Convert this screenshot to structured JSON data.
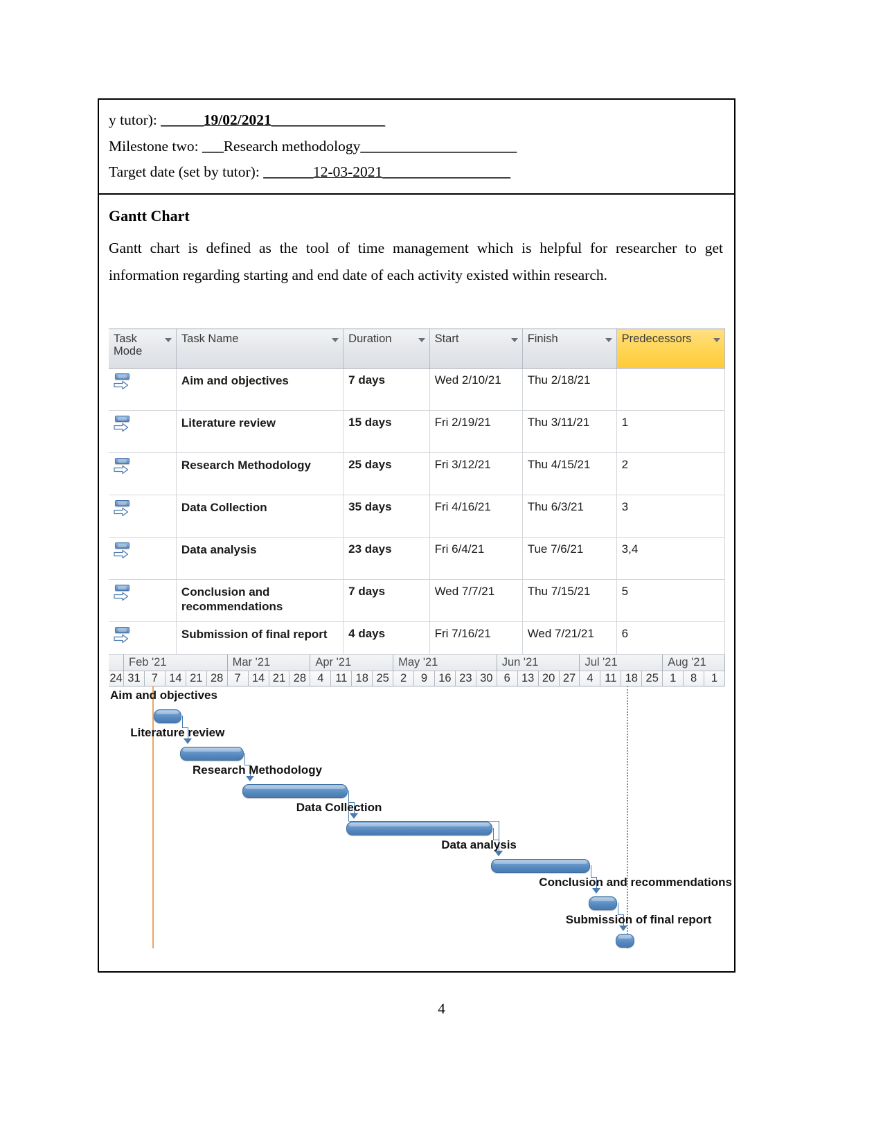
{
  "header": {
    "line1_prefix": "y tutor): ",
    "line1_blank_before": "______",
    "line1_value": "19/02/2021",
    "line1_blank_after": "________________",
    "line2_prefix": "Milestone two: ",
    "line2_blank_before": "___",
    "line2_value": "Research methodology",
    "line2_blank_after": "______________________",
    "line3_prefix": "Target date (set by tutor): ",
    "line3_blank_before": "_______",
    "line3_value": "12-03-2021",
    "line3_blank_after": "__________________"
  },
  "section": {
    "title": "Gantt Chart",
    "paragraph": "Gantt chart is defined as the tool of time management which is helpful for researcher to get information regarding starting and end date of each activity existed within research."
  },
  "project_table": {
    "columns": [
      {
        "label": "Task Mode",
        "highlight": false
      },
      {
        "label": "Task Name",
        "highlight": false
      },
      {
        "label": "Duration",
        "highlight": false
      },
      {
        "label": "Start",
        "highlight": false
      },
      {
        "label": "Finish",
        "highlight": false
      },
      {
        "label": "Predecessors",
        "highlight": true
      }
    ],
    "rows": [
      {
        "mode_icon": "auto-schedule-icon",
        "name": "Aim and objectives",
        "duration": "7 days",
        "start": "Wed 2/10/21",
        "finish": "Thu 2/18/21",
        "predecessors": ""
      },
      {
        "mode_icon": "auto-schedule-icon",
        "name": "Literature review",
        "duration": "15 days",
        "start": "Fri 2/19/21",
        "finish": "Thu 3/11/21",
        "predecessors": "1"
      },
      {
        "mode_icon": "auto-schedule-icon",
        "name": "Research Methodology",
        "duration": "25 days",
        "start": "Fri 3/12/21",
        "finish": "Thu 4/15/21",
        "predecessors": "2"
      },
      {
        "mode_icon": "auto-schedule-icon",
        "name": "Data Collection",
        "duration": "35 days",
        "start": "Fri 4/16/21",
        "finish": "Thu 6/3/21",
        "predecessors": "3"
      },
      {
        "mode_icon": "auto-schedule-icon",
        "name": "Data analysis",
        "duration": "23 days",
        "start": "Fri 6/4/21",
        "finish": "Tue 7/6/21",
        "predecessors": "3,4"
      },
      {
        "mode_icon": "auto-schedule-icon",
        "name": "Conclusion and recommendations",
        "duration": "7 days",
        "start": "Wed 7/7/21",
        "finish": "Thu 7/15/21",
        "predecessors": "5"
      },
      {
        "mode_icon": "auto-schedule-icon",
        "name": "Submission of final report",
        "duration": "4 days",
        "start": "Fri 7/16/21",
        "finish": "Wed 7/21/21",
        "predecessors": "6"
      }
    ]
  },
  "chart_data": {
    "type": "bar",
    "title": "Gantt Chart",
    "xlabel": "",
    "ylabel": "",
    "timeline": {
      "months": [
        "Feb '21",
        "Mar '21",
        "Apr '21",
        "May '21",
        "Jun '21",
        "Jul '21",
        "Aug '21"
      ],
      "weeks": [
        "24",
        "31",
        "7",
        "14",
        "21",
        "28",
        "7",
        "14",
        "21",
        "28",
        "4",
        "11",
        "18",
        "25",
        "2",
        "9",
        "16",
        "23",
        "30",
        "6",
        "13",
        "20",
        "27",
        "4",
        "11",
        "18",
        "25",
        "1",
        "8",
        "1"
      ]
    },
    "tasks": [
      {
        "name": "Aim and objectives",
        "start": "2021-02-10",
        "finish": "2021-02-18",
        "duration_days": 7,
        "predecessors": []
      },
      {
        "name": "Literature review",
        "start": "2021-02-19",
        "finish": "2021-03-11",
        "duration_days": 15,
        "predecessors": [
          1
        ]
      },
      {
        "name": "Research Methodology",
        "start": "2021-03-12",
        "finish": "2021-04-15",
        "duration_days": 25,
        "predecessors": [
          2
        ]
      },
      {
        "name": "Data Collection",
        "start": "2021-04-16",
        "finish": "2021-06-03",
        "duration_days": 35,
        "predecessors": [
          3
        ]
      },
      {
        "name": "Data analysis",
        "start": "2021-06-04",
        "finish": "2021-07-06",
        "duration_days": 23,
        "predecessors": [
          3,
          4
        ]
      },
      {
        "name": "Conclusion and recommendations",
        "start": "2021-07-07",
        "finish": "2021-07-15",
        "duration_days": 7,
        "predecessors": [
          5
        ]
      },
      {
        "name": "Submission of final report",
        "start": "2021-07-16",
        "finish": "2021-07-21",
        "duration_days": 4,
        "predecessors": [
          6
        ]
      }
    ],
    "colors": {
      "bar": "#5185bc",
      "bar_border": "#3d6da0",
      "status_line": "#e8a860",
      "today_line": "#8a8a8a",
      "header_highlight": "#ffd451"
    }
  },
  "footer": {
    "page_number": "4"
  }
}
